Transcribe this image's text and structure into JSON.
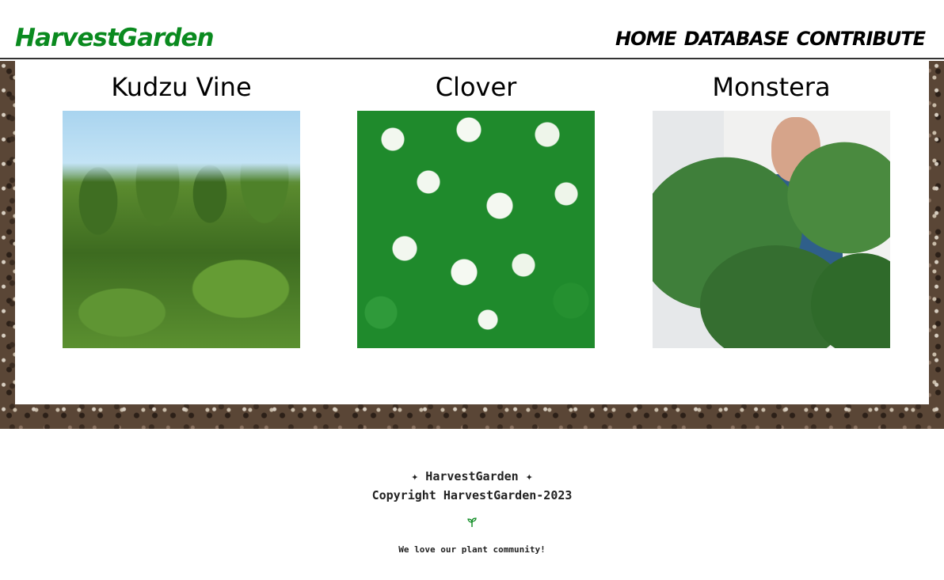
{
  "header": {
    "logo": "HarvestGarden",
    "nav": [
      "HOME",
      "DATABASE",
      "CONTRIBUTE"
    ]
  },
  "cards": [
    {
      "title": "Kudzu Vine",
      "image": "kudzu-vine-photo"
    },
    {
      "title": "Clover",
      "image": "clover-photo"
    },
    {
      "title": "Monstera",
      "image": "monstera-photo"
    }
  ],
  "footer": {
    "brand_line": "✦ HarvestGarden ✦",
    "copyright": "Copyright HarvestGarden-2023",
    "icon": "sprout-icon",
    "tagline": "We love our plant community!"
  },
  "colors": {
    "brand_green": "#0a8a1f",
    "nav_text": "#000000"
  }
}
